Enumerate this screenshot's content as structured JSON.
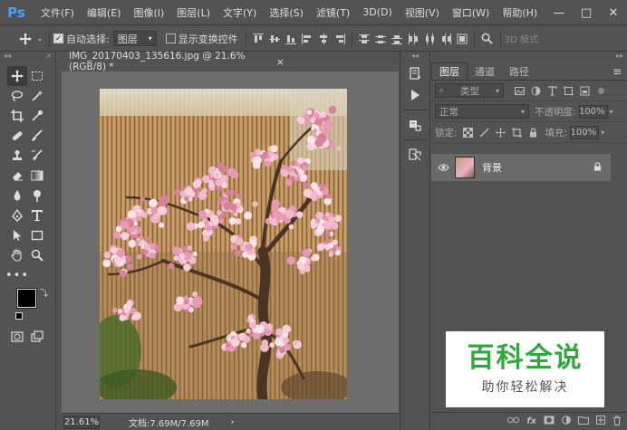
{
  "app": {
    "logo": "Ps",
    "menus": [
      "文件(F)",
      "编辑(E)",
      "图像(I)",
      "图层(L)",
      "文字(Y)",
      "选择(S)",
      "滤镜(T)",
      "3D(D)",
      "视图(V)",
      "窗口(W)",
      "帮助(H)"
    ],
    "window_controls": {
      "minimize": "—",
      "restore": "□",
      "close": "✕"
    }
  },
  "options": {
    "auto_select_label": "自动选择:",
    "auto_select_checked": true,
    "auto_select_target": "图层",
    "show_transform_label": "显示变换控件",
    "show_transform_checked": false,
    "mode_3d": "3D 模式"
  },
  "document": {
    "tab_title": "IMG_20170403_135616.jpg @ 21.6%(RGB/8) *",
    "close": "×",
    "zoom": "21.61%",
    "doc_info": "文档:7.69M/7.69M",
    "status_arrow": "›"
  },
  "colors": {
    "foreground": "#000000",
    "background": "#ffffff",
    "accent": "#4aa3ff"
  },
  "layers_panel": {
    "tabs": [
      "图层",
      "通道",
      "路径"
    ],
    "active_tab": 0,
    "filter_type": "类型",
    "blend_mode": "正常",
    "opacity_label": "不透明度:",
    "opacity": "100%",
    "lock_label": "锁定:",
    "fill_label": "填充:",
    "fill": "100%",
    "layers": [
      {
        "name": "背景",
        "visible": true,
        "locked": true
      }
    ],
    "bottom_icons": [
      "link-icon",
      "fx-icon",
      "mask-icon",
      "adjustment-icon",
      "group-icon",
      "new-layer-icon",
      "trash-icon"
    ],
    "fx_label": "fx"
  },
  "watermark": {
    "title": "百科全说",
    "subtitle": "助你轻松解决"
  }
}
